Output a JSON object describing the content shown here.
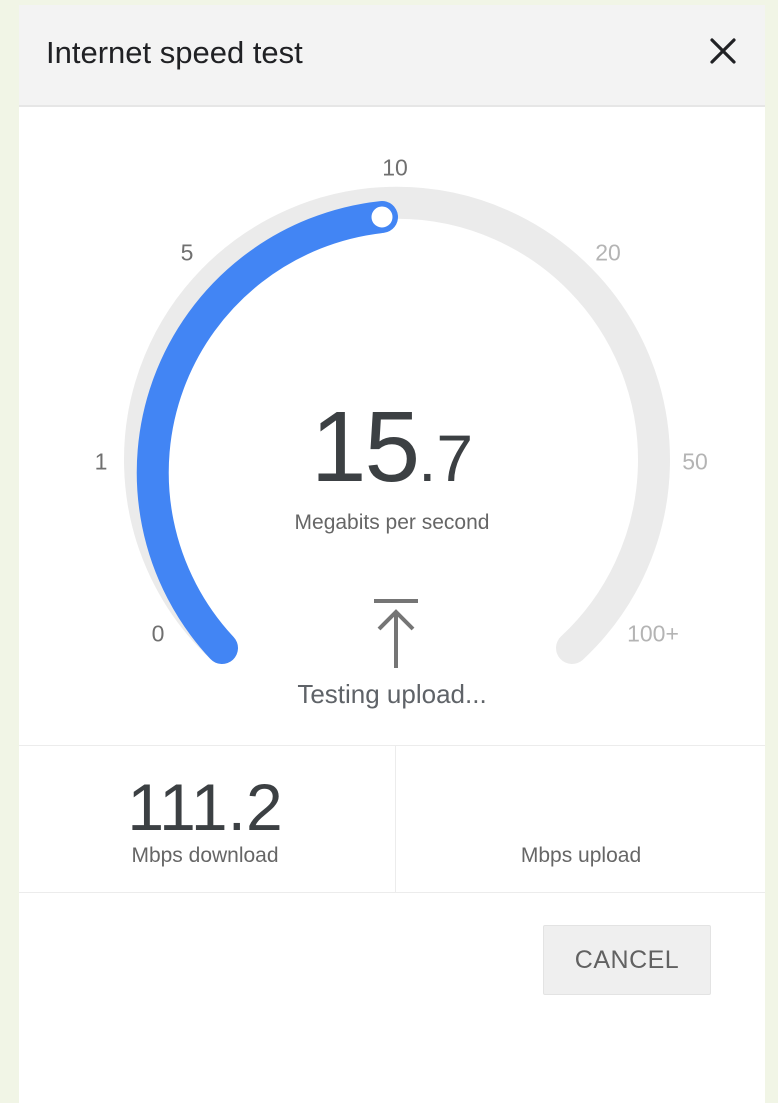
{
  "dialog": {
    "title": "Internet speed test",
    "close_icon": "close-icon"
  },
  "gauge": {
    "ticks": [
      "0",
      "1",
      "5",
      "10",
      "20",
      "50",
      "100+"
    ],
    "active_until_tick": "10",
    "current_value": "15",
    "current_decimal": ".7",
    "unit": "Megabits per second",
    "status_icon": "upload-arrow-icon",
    "status": "Testing upload...",
    "colors": {
      "active": "#4285f4",
      "track": "#ebebeb"
    }
  },
  "results": {
    "download_value": "111.2",
    "download_label": "Mbps download",
    "upload_value": "",
    "upload_label": "Mbps upload"
  },
  "actions": {
    "cancel_label": "CANCEL"
  }
}
